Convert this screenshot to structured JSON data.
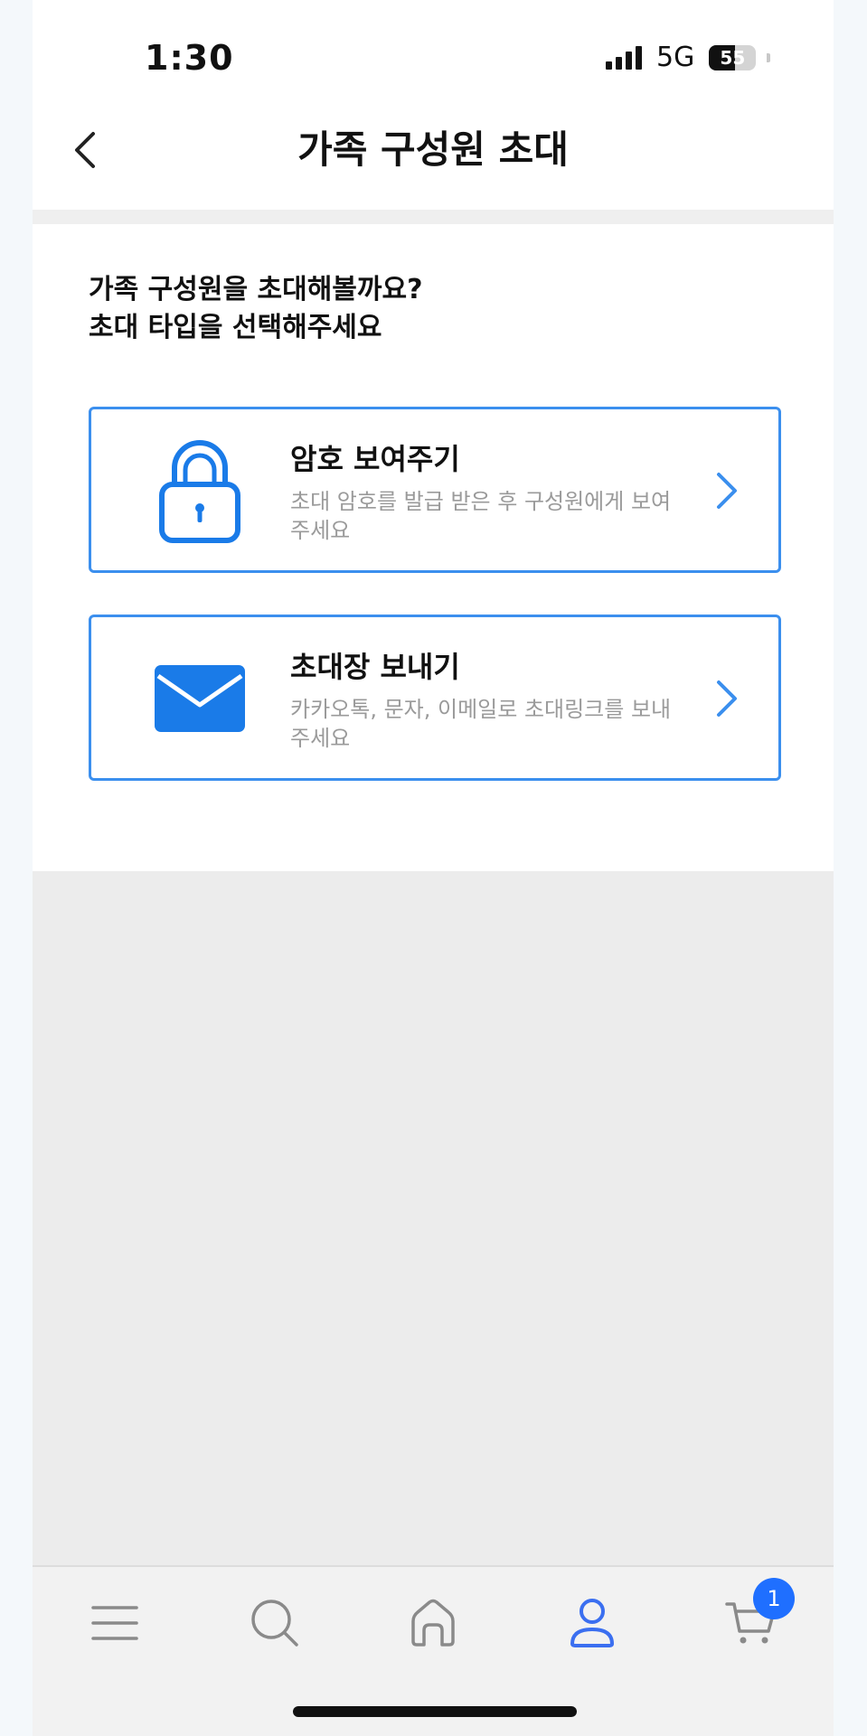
{
  "status_bar": {
    "time": "1:30",
    "network": "5G",
    "battery": "55",
    "battery_fill_percent": 55
  },
  "header": {
    "title": "가족 구성원 초대",
    "back_icon": "chevron-left-icon"
  },
  "intro": {
    "line1": "가족 구성원을 초대해볼까요?",
    "line2": "초대 타입을 선택해주세요"
  },
  "options": [
    {
      "icon": "lock-icon",
      "title": "암호 보여주기",
      "description": "초대 암호를 발급 받은 후 구성원에게 보여주세요"
    },
    {
      "icon": "envelope-icon",
      "title": "초대장 보내기",
      "description": "카카오톡, 문자, 이메일로 초대링크를 보내주세요"
    }
  ],
  "tab_bar": {
    "items": [
      {
        "icon": "menu-icon",
        "active": false
      },
      {
        "icon": "search-icon",
        "active": false
      },
      {
        "icon": "home-icon",
        "active": false
      },
      {
        "icon": "user-icon",
        "active": true
      },
      {
        "icon": "cart-icon",
        "active": false
      }
    ],
    "cart_badge": "1"
  },
  "colors": {
    "accent": "#3b8fee",
    "icon_blue": "#1a7be8",
    "badge_blue": "#1f6fff",
    "inactive_icon": "#8a8a8a",
    "description_gray": "#9a9a9a"
  }
}
